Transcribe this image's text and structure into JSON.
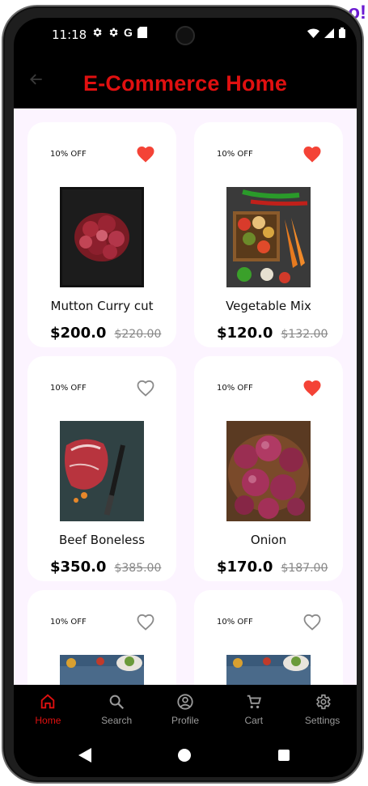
{
  "status": {
    "time": "11:18",
    "icons": [
      "gear-icon",
      "gear-icon",
      "google-g-icon",
      "sd-card-icon"
    ],
    "right_icons": [
      "wifi-icon",
      "signal-icon",
      "battery-icon"
    ]
  },
  "appbar": {
    "title": "E-Commerce Home",
    "back_icon": "arrow-back-icon"
  },
  "products": [
    {
      "name": "Mutton Curry cut",
      "price": "$200.0",
      "old_price": "$220.00",
      "discount": "10% OFF",
      "favorite": true
    },
    {
      "name": "Vegetable Mix",
      "price": "$120.0",
      "old_price": "$132.00",
      "discount": "10% OFF",
      "favorite": true
    },
    {
      "name": "Beef Boneless",
      "price": "$350.0",
      "old_price": "$385.00",
      "discount": "10% OFF",
      "favorite": false
    },
    {
      "name": "Onion",
      "price": "$170.0",
      "old_price": "$187.00",
      "discount": "10% OFF",
      "favorite": true
    },
    {
      "name": "",
      "price": "",
      "old_price": "",
      "discount": "10% OFF",
      "favorite": false
    },
    {
      "name": "",
      "price": "",
      "old_price": "",
      "discount": "10% OFF",
      "favorite": false
    }
  ],
  "bottom_nav": [
    {
      "label": "Home",
      "icon": "home-icon",
      "active": true
    },
    {
      "label": "Search",
      "icon": "search-icon",
      "active": false
    },
    {
      "label": "Profile",
      "icon": "profile-icon",
      "active": false
    },
    {
      "label": "Cart",
      "icon": "cart-icon",
      "active": false
    },
    {
      "label": "Settings",
      "icon": "settings-icon",
      "active": false
    }
  ],
  "colors": {
    "accent": "#e01010",
    "favorite": "#f44336",
    "background": "#fcf4ff",
    "card": "#ffffff"
  }
}
